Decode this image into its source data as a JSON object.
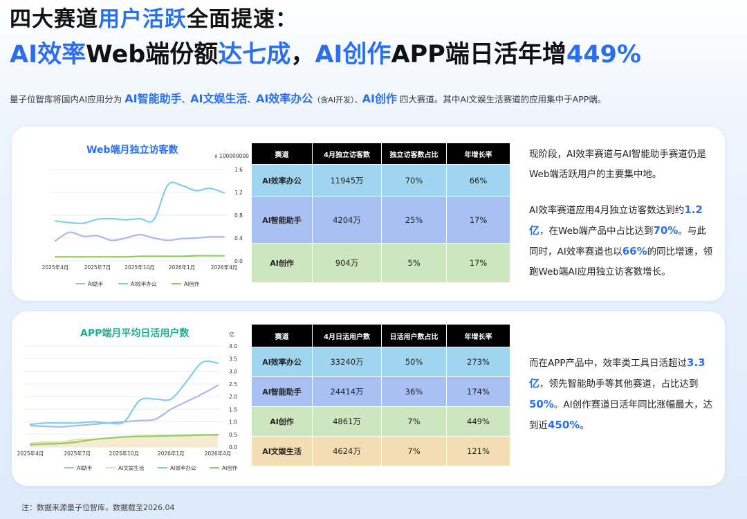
{
  "header": {
    "line1_a": "四大赛道",
    "line1_b": "用户活跃",
    "line1_c": "全面提速：",
    "line2_a": "AI效率",
    "line2_b": "Web端份额",
    "line2_c": "达七成",
    "line2_d": "，",
    "line2_e": "AI创作",
    "line2_f": "APP端日活年增",
    "line2_g": "449%"
  },
  "intro": {
    "t1": "量子位智库将国内AI应用分为",
    "h1": "AI智能助手",
    "t2": "、",
    "h2": "AI文娱生活",
    "t3": "、",
    "h3": "AI效率办公",
    "t4": "（含AI开发）、",
    "h4": "AI创作",
    "t5": "四大赛道。其中AI文娱生活赛道的应用集中于APP端。"
  },
  "colors": {
    "accent": "#2a6ff0",
    "web_title": "#2a6ff0",
    "app_title": "#1fae8a",
    "assistant": "#a9b8ee",
    "office": "#7ccfea",
    "creation": "#8bcf64",
    "life": "#f0dca8"
  },
  "chart_web": {
    "title": "Web端月独立访客数",
    "unit": "x 100000000",
    "chart_data": {
      "type": "line",
      "x": [
        "2025年4月",
        "2025年5月",
        "2025年6月",
        "2025年7月",
        "2025年8月",
        "2025年9月",
        "2025年10月",
        "2025年11月",
        "2025年12月",
        "2026年1月",
        "2026年2月",
        "2026年3月",
        "2026年4月"
      ],
      "x_ticks": [
        "2025年4月",
        "2025年7月",
        "2025年10月",
        "2026年1月",
        "2026年4月"
      ],
      "y_ticks": [
        "0.0",
        "0.4",
        "0.8",
        "1.2",
        "1.6"
      ],
      "ylim": [
        0,
        1.6
      ],
      "series": [
        {
          "name": "AI助手",
          "values": [
            0.35,
            0.5,
            0.43,
            0.44,
            0.36,
            0.4,
            0.46,
            0.4,
            0.36,
            0.39,
            0.4,
            0.42,
            0.42
          ]
        },
        {
          "name": "AI效率办公",
          "values": [
            0.7,
            0.67,
            0.66,
            0.73,
            0.74,
            0.72,
            0.74,
            0.72,
            1.33,
            1.32,
            1.23,
            1.27,
            1.19
          ]
        },
        {
          "name": "AI创作",
          "values": [
            0.07,
            0.07,
            0.07,
            0.07,
            0.07,
            0.07,
            0.08,
            0.08,
            0.08,
            0.08,
            0.09,
            0.09,
            0.09
          ]
        }
      ]
    }
  },
  "table_web": {
    "headers": [
      "赛道",
      "4月独立访客数",
      "独立访客数占比",
      "年增长率"
    ],
    "rows": [
      [
        "AI效率办公",
        "11945万",
        "70%",
        "66%"
      ],
      [
        "AI智能助手",
        "4204万",
        "25%",
        "17%"
      ],
      [
        "AI创作",
        "904万",
        "5%",
        "17%"
      ]
    ]
  },
  "para_web": {
    "p1": "现阶段，AI效率赛道与AI智能助手赛道仍是Web端活跃用户的主要集中地。",
    "p2_a": "AI效率赛道应用4月独立访客数达到约",
    "p2_b": "1.2亿",
    "p2_c": "，在Web端产品中占比达到",
    "p2_d": "70%",
    "p2_e": "。与此同时，AI效率赛道也以",
    "p2_f": "66%",
    "p2_g": "的同比增速，领跑Web端AI应用独立访客数增长。"
  },
  "chart_app": {
    "title": "APP端月平均日活用户数",
    "unit": "亿",
    "chart_data": {
      "type": "line",
      "x": [
        "2025年4月",
        "2025年5月",
        "2025年6月",
        "2025年7月",
        "2025年8月",
        "2025年9月",
        "2025年10月",
        "2025年11月",
        "2025年12月",
        "2026年1月",
        "2026年2月",
        "2026年3月",
        "2026年4月"
      ],
      "x_ticks": [
        "2025年4月",
        "2025年7月",
        "2025年10月",
        "2026年1月",
        "2026年4月"
      ],
      "y_ticks": [
        "0.0",
        "0.5",
        "1.0",
        "1.5",
        "2.0",
        "2.5",
        "3.0",
        "3.5",
        "4.0"
      ],
      "ylim": [
        0,
        4.0
      ],
      "series": [
        {
          "name": "AI助手",
          "values": [
            0.85,
            0.82,
            0.8,
            0.85,
            0.9,
            0.95,
            1.0,
            1.05,
            1.1,
            1.5,
            1.8,
            2.1,
            2.44
          ]
        },
        {
          "name": "AI文娱生活",
          "values": [
            0.15,
            0.2,
            0.2,
            0.3,
            0.3,
            0.35,
            0.4,
            0.45,
            0.45,
            0.45,
            0.45,
            0.46,
            0.46
          ]
        },
        {
          "name": "AI效率办公",
          "values": [
            0.9,
            0.95,
            0.95,
            0.95,
            1.0,
            0.95,
            1.0,
            1.85,
            1.9,
            1.9,
            2.6,
            3.35,
            3.32
          ]
        },
        {
          "name": "AI创作",
          "values": [
            0.09,
            0.12,
            0.14,
            0.2,
            0.3,
            0.35,
            0.4,
            0.42,
            0.43,
            0.45,
            0.46,
            0.48,
            0.49
          ]
        }
      ]
    }
  },
  "table_app": {
    "headers": [
      "赛道",
      "4月日活用户数",
      "日活用户数占比",
      "年增长率"
    ],
    "rows": [
      [
        "AI效率办公",
        "33240万",
        "50%",
        "273%"
      ],
      [
        "AI智能助手",
        "24414万",
        "36%",
        "174%"
      ],
      [
        "AI创作",
        "4861万",
        "7%",
        "449%"
      ],
      [
        "AI文娱生活",
        "4624万",
        "7%",
        "121%"
      ]
    ]
  },
  "para_app": {
    "a": "而在APP产品中，效率类工具日活超过",
    "b": "3.3亿",
    "c": "，领先智能助手等其他赛道，占比达到",
    "d": "50%",
    "e": "。AI创作赛道日活年同比涨幅最大，达到近",
    "f": "450%",
    "g": "。"
  },
  "footnote": "注：数据来源量子位智库，数据截至2026.04"
}
